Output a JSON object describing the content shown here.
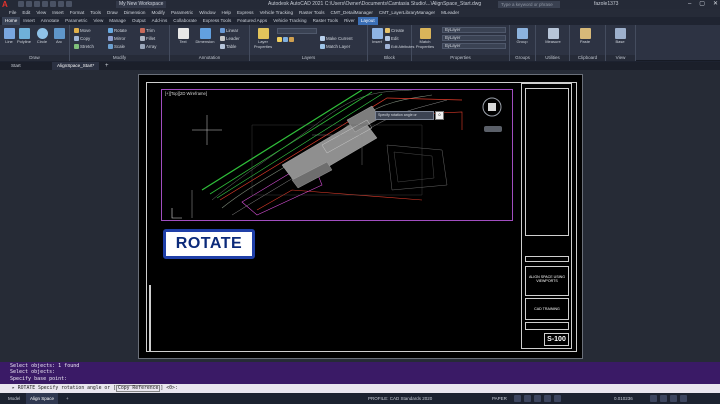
{
  "title_bar": {
    "app_logo": "A",
    "workspace": "My New Workspace",
    "title": "Autodesk AutoCAD 2021  C:\\Users\\Owner\\Documents\\Camtasia Studio\\...\\AlignSpace_Start.dwg",
    "search_placeholder": "Type a keyword or phrase",
    "user": "fazole1373"
  },
  "menu": [
    "File",
    "Edit",
    "View",
    "Insert",
    "Format",
    "Tools",
    "Draw",
    "Dimension",
    "Modify",
    "Parametric",
    "Window",
    "Help",
    "Express",
    "Vehicle Tracking",
    "Raster Tools",
    "CMT_DetailManager",
    "CMT_LayerLibraryManager",
    "MLeader"
  ],
  "ribbon_tabs": [
    "Home",
    "Insert",
    "Annotate",
    "Parametric",
    "View",
    "Manage",
    "Output",
    "Add-ins",
    "Collaborate",
    "Express Tools",
    "Featured Apps",
    "Vehicle Tracking",
    "Raster Tools",
    "River",
    "Layout"
  ],
  "ribbon": {
    "draw": {
      "title": "Draw",
      "tools": [
        "Line",
        "Polyline",
        "Circle",
        "Arc"
      ]
    },
    "modify": {
      "title": "Modify",
      "tools": [
        "Move",
        "Rotate",
        "Trim",
        "Copy",
        "Mirror",
        "Fillet",
        "Stretch",
        "Scale",
        "Array"
      ]
    },
    "annotation": {
      "title": "Annotation",
      "tools": [
        "Text",
        "Dimension",
        "Linear",
        "Leader",
        "Table"
      ]
    },
    "layers": {
      "title": "Layers",
      "tools": [
        "Layer Properties",
        "Make Current",
        "Match Layer"
      ]
    },
    "block": {
      "title": "Block",
      "tools": [
        "Insert",
        "Create",
        "Edit",
        "Edit Attributes"
      ]
    },
    "properties": {
      "title": "Properties",
      "tools": [
        "Match Properties"
      ],
      "dropdowns": [
        "ByLayer",
        "ByLayer",
        "ByLayer"
      ]
    },
    "groups": {
      "title": "Groups",
      "tools": [
        "Group"
      ]
    },
    "utilities": {
      "title": "Utilities",
      "tools": [
        "Measure"
      ]
    },
    "clipboard": {
      "title": "Clipboard",
      "tools": [
        "Paste"
      ]
    },
    "view": {
      "title": "View",
      "tools": [
        "Base"
      ]
    }
  },
  "file_tabs": [
    "Start",
    "AlignSpace_Start*"
  ],
  "viewport": {
    "label": "[+][Top][2D Wireframe]"
  },
  "tooltip": {
    "prompt": "Specify rotation angle or",
    "value": "0"
  },
  "overlay": {
    "label": "ROTATE"
  },
  "title_block": {
    "heading": "ALIGN SPACE USING VIEWPORTS",
    "firm": "CAD TRAINING",
    "sheet": "S-100"
  },
  "command_history": [
    "Select objects: 1 found",
    "Select objects:",
    "Specify base point:"
  ],
  "command_line": {
    "prefix": "ROTATE",
    "text": "Specify rotation angle or [",
    "option": "Copy Reference",
    "suffix": "] <0>:"
  },
  "status": {
    "model_tab": "Model",
    "layout_tab": "Align Space",
    "right_text": "PROFILE: CAD Standards 2020",
    "paper": "PAPER",
    "scale": "0.010236"
  },
  "colors": {
    "accent": "#3b6fb6",
    "command_bg": "#3a1a66",
    "viewport_border": "#a14ec0"
  }
}
